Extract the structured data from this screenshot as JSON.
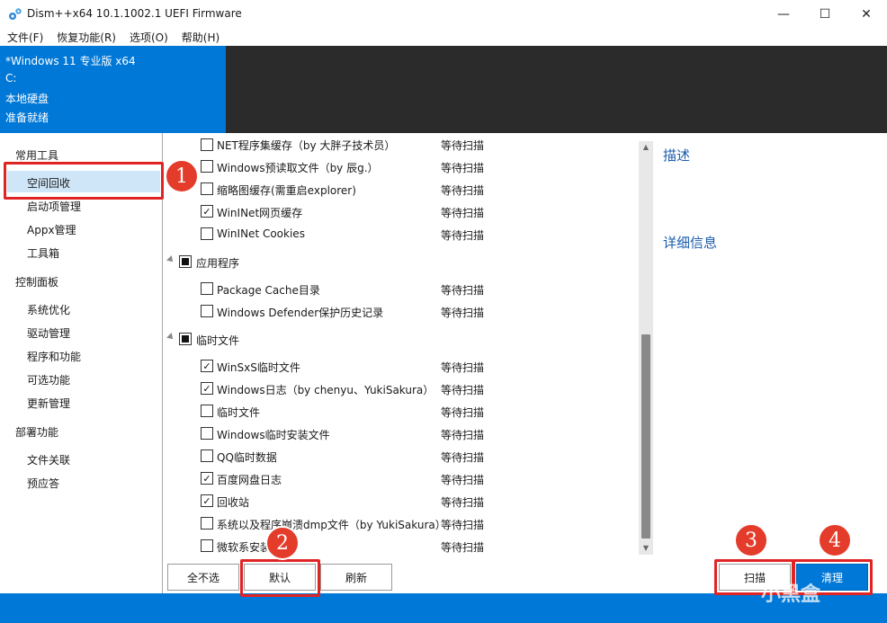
{
  "window": {
    "title": "Dism++x64 10.1.1002.1 UEFI Firmware",
    "minimize_glyph": "—",
    "maximize_glyph": "☐",
    "close_glyph": "✕"
  },
  "menu": [
    "文件(F)",
    "恢复功能(R)",
    "选项(O)",
    "帮助(H)"
  ],
  "header": {
    "lines": [
      "*Windows 11 专业版 x64",
      "C:",
      "本地硬盘",
      "准备就绪"
    ],
    "accent": "#0078d7",
    "dark": "#2b2b2b"
  },
  "sidebar": {
    "groups": [
      {
        "label": "常用工具",
        "items": [
          "空间回收",
          "启动项管理",
          "Appx管理",
          "工具箱"
        ]
      },
      {
        "label": "控制面板",
        "items": [
          "系统优化",
          "驱动管理",
          "程序和功能",
          "可选功能",
          "更新管理"
        ]
      },
      {
        "label": "部署功能",
        "items": [
          "文件关联",
          "预应答"
        ]
      }
    ],
    "selected": "空间回收"
  },
  "list": {
    "rows": [
      {
        "type": "item",
        "label": "NET程序集缓存（by 大胖子技术员）",
        "status": "等待扫描",
        "checked": false
      },
      {
        "type": "item",
        "label": "Windows预读取文件（by 辰g.）",
        "status": "等待扫描",
        "checked": false
      },
      {
        "type": "item",
        "label": "缩略图缓存(需重启explorer)",
        "status": "等待扫描",
        "checked": false
      },
      {
        "type": "item",
        "label": "WinINet网页缓存",
        "status": "等待扫描",
        "checked": true
      },
      {
        "type": "item",
        "label": "WinINet Cookies",
        "status": "等待扫描",
        "checked": false
      },
      {
        "type": "group",
        "label": "应用程序"
      },
      {
        "type": "item",
        "label": "Package Cache目录",
        "status": "等待扫描",
        "checked": false
      },
      {
        "type": "item",
        "label": "Windows Defender保护历史记录",
        "status": "等待扫描",
        "checked": false
      },
      {
        "type": "group",
        "label": "临时文件"
      },
      {
        "type": "item",
        "label": "WinSxS临时文件",
        "status": "等待扫描",
        "checked": true
      },
      {
        "type": "item",
        "label": "Windows日志（by chenyu、YukiSakura）",
        "status": "等待扫描",
        "checked": true
      },
      {
        "type": "item",
        "label": "临时文件",
        "status": "等待扫描",
        "checked": false
      },
      {
        "type": "item",
        "label": "Windows临时安装文件",
        "status": "等待扫描",
        "checked": false
      },
      {
        "type": "item",
        "label": "QQ临时数据",
        "status": "等待扫描",
        "checked": false
      },
      {
        "type": "item",
        "label": "百度网盘日志",
        "status": "等待扫描",
        "checked": true
      },
      {
        "type": "item",
        "label": "回收站",
        "status": "等待扫描",
        "checked": true
      },
      {
        "type": "item",
        "label": "系统以及程序崩溃dmp文件（by YukiSakura）",
        "status": "等待扫描",
        "checked": false
      },
      {
        "type": "item",
        "label": "微软系安装文件",
        "status": "等待扫描",
        "checked": false
      }
    ],
    "check_glyph": "✓"
  },
  "details": {
    "desc_title": "描述",
    "info_title": "详细信息"
  },
  "buttons": {
    "select_none": "全不选",
    "default": "默认",
    "refresh": "刷新",
    "scan": "扫描",
    "clean": "清理"
  },
  "annotations": {
    "badges": [
      "1",
      "2",
      "3",
      "4"
    ],
    "color": "#e43c2b"
  },
  "watermark": "小黑盒"
}
